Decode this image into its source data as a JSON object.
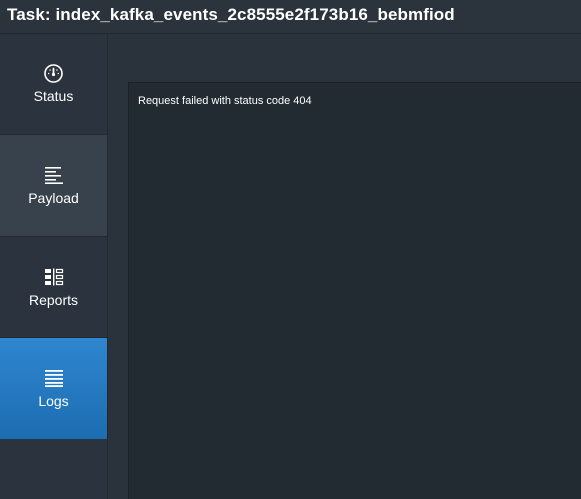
{
  "header": {
    "title": "Task: index_kafka_events_2c8555e2f173b16_bebmfiod"
  },
  "sidebar": {
    "items": [
      {
        "label": "Status",
        "icon": "gauge-icon",
        "active": false
      },
      {
        "label": "Payload",
        "icon": "align-left-icon",
        "active": false
      },
      {
        "label": "Reports",
        "icon": "reports-icon",
        "active": false
      },
      {
        "label": "Logs",
        "icon": "list-lines-icon",
        "active": true
      }
    ]
  },
  "logs": {
    "message": "Request failed with status code 404"
  },
  "colors": {
    "active_tab": "#2580c8",
    "hover_tab": "#38424c",
    "background": "#2a333c",
    "panel": "#222a32",
    "text": "#ffffff"
  }
}
